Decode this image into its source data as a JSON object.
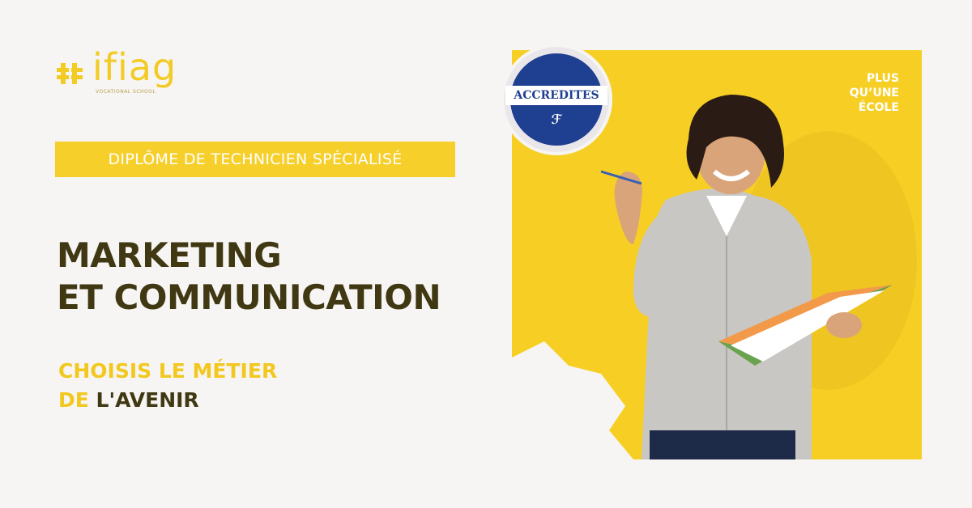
{
  "brand": {
    "name": "ifiag",
    "subtitle": "VOCATIONAL SCHOOL",
    "accent_color": "#f6cf2b",
    "text_color": "#3f3812"
  },
  "diploma_label": "DIPLÔME DE TECHNICIEN SPÉCIALISÉ",
  "title_lines": [
    "MARKETING",
    "ET COMMUNICATION"
  ],
  "subtitle": {
    "line1": "CHOISIS LE MÉTIER",
    "line2_prefix": "DE",
    "line2_rest": " L'AVENIR"
  },
  "tagline": [
    "PLUS",
    "QU’UNE",
    "ÉCOLE"
  ],
  "badge": {
    "main": "ACCREDITES",
    "icon": "fp-monogram-icon"
  },
  "image": {
    "subject": "student-photo",
    "icon": "student-with-notebook-icon"
  }
}
